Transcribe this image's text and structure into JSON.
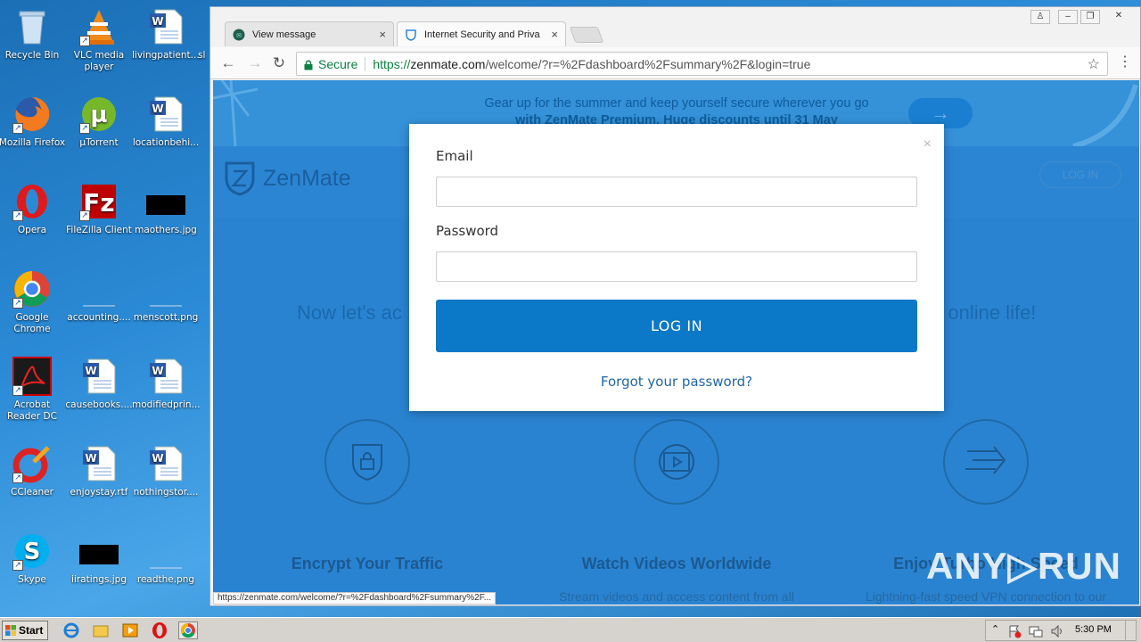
{
  "desktop": {
    "icons": [
      {
        "label": "Recycle Bin",
        "icon": "recycle-bin-icon"
      },
      {
        "label": "VLC media player",
        "icon": "vlc-icon"
      },
      {
        "label": "livingpatient....",
        "icon": "word-document-icon"
      },
      {
        "label": "Mozilla Firefox",
        "icon": "firefox-icon"
      },
      {
        "label": "µTorrent",
        "icon": "utorrent-icon"
      },
      {
        "label": "locationbehi...",
        "icon": "word-document-icon"
      },
      {
        "label": "Opera",
        "icon": "opera-icon"
      },
      {
        "label": "FileZilla Client",
        "icon": "filezilla-icon"
      },
      {
        "label": "maothers.jpg",
        "icon": "image-file-icon"
      },
      {
        "label": "Google Chrome",
        "icon": "chrome-icon"
      },
      {
        "label": "accounting....",
        "icon": "blank-file-icon"
      },
      {
        "label": "menscott.png",
        "icon": "blank-file-icon"
      },
      {
        "label": "Acrobat Reader DC",
        "icon": "acrobat-icon"
      },
      {
        "label": "causebooks....",
        "icon": "word-document-icon"
      },
      {
        "label": "modifiedprin....",
        "icon": "word-document-icon"
      },
      {
        "label": "CCleaner",
        "icon": "ccleaner-icon"
      },
      {
        "label": "enjoystay.rtf",
        "icon": "word-document-icon"
      },
      {
        "label": "nothingstor....",
        "icon": "word-document-icon"
      },
      {
        "label": "Skype",
        "icon": "skype-icon"
      },
      {
        "label": "iiratings.jpg",
        "icon": "image-file-icon"
      },
      {
        "label": "readthe.png",
        "icon": "blank-file-icon"
      }
    ],
    "cut_label": "sl"
  },
  "browser": {
    "tabs": [
      {
        "title": "View message",
        "close": "×"
      },
      {
        "title": "Internet Security and Priva",
        "close": "×"
      }
    ],
    "address": {
      "secure_label": "Secure",
      "scheme": "https://",
      "host": "zenmate.com",
      "path": "/welcome/?r=%2Fdashboard%2Fsummary%2F&login=true"
    },
    "status_url": "https://zenmate.com/welcome/?r=%2Fdashboard%2Fsummary%2F..."
  },
  "page": {
    "banner_line1": "Gear up for the summer and keep yourself secure wherever you go",
    "banner_line2": "with ZenMate Premium. Huge discounts until 31 May",
    "banner_arrow": "→",
    "logo_text": "ZenMate",
    "login_top": "LOG IN",
    "hero_left": "Now let's ac",
    "hero_right": "d online life!",
    "features": [
      {
        "title": "Encrypt Your Traffic",
        "desc": "",
        "icon": "lock-shield-icon"
      },
      {
        "title": "Watch Videos Worldwide",
        "desc": "Stream videos and access content from all",
        "icon": "video-globe-icon"
      },
      {
        "title": "Enjoy Turbo High Speed",
        "desc": "Lightning-fast speed VPN connection to our",
        "icon": "speed-arrows-icon"
      }
    ],
    "watermark": "ANY▷RUN"
  },
  "modal": {
    "close": "×",
    "email_label": "Email",
    "email_value": "",
    "password_label": "Password",
    "password_value": "",
    "login_button": "LOG IN",
    "forgot_link": "Forgot your password?"
  },
  "taskbar": {
    "start_label": "Start",
    "clock": "5:30 PM"
  }
}
